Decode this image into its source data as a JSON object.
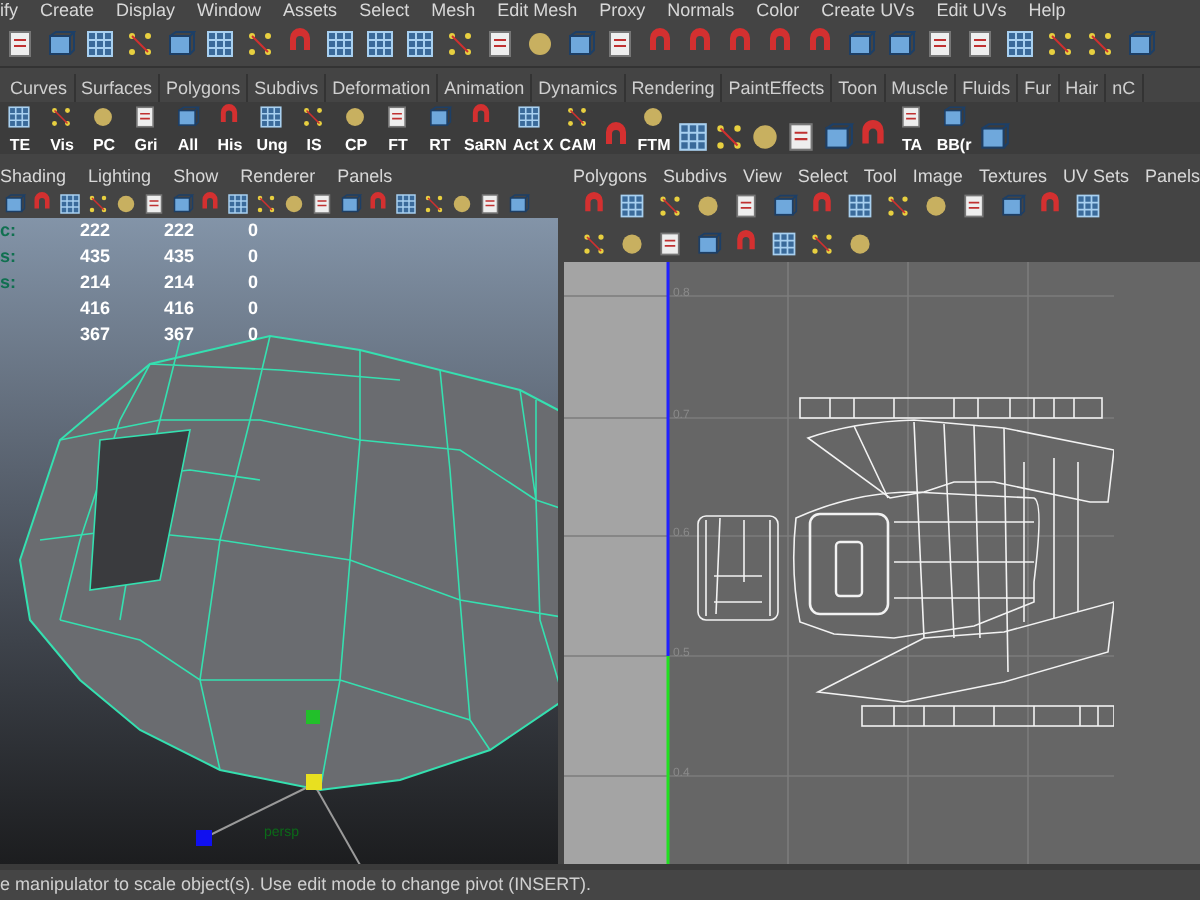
{
  "menu_bar": [
    "ify",
    "Create",
    "Display",
    "Window",
    "Assets",
    "Select",
    "Mesh",
    "Edit Mesh",
    "Proxy",
    "Normals",
    "Color",
    "Create UVs",
    "Edit UVs",
    "Help"
  ],
  "shelf_tabs": [
    {
      "label": "Curves",
      "selected": false
    },
    {
      "label": "Surfaces",
      "selected": false
    },
    {
      "label": "Polygons",
      "selected": false
    },
    {
      "label": "Subdivs",
      "selected": false
    },
    {
      "label": "Deformation",
      "selected": false
    },
    {
      "label": "Animation",
      "selected": false
    },
    {
      "label": "Dynamics",
      "selected": false
    },
    {
      "label": "Rendering",
      "selected": false
    },
    {
      "label": "PaintEffects",
      "selected": false
    },
    {
      "label": "Toon",
      "selected": false
    },
    {
      "label": "Muscle",
      "selected": false
    },
    {
      "label": "Fluids",
      "selected": false
    },
    {
      "label": "Fur",
      "selected": false
    },
    {
      "label": "Hair",
      "selected": false
    },
    {
      "label": "nC",
      "selected": false
    }
  ],
  "shelf_buttons": [
    "TE",
    "Vis",
    "PC",
    "Gri",
    "All",
    "His",
    "Ung",
    "IS",
    "CP",
    "FT",
    "RT",
    "SaRN",
    "Act X",
    "CAM",
    "FTM",
    "TA",
    "BB(r"
  ],
  "viewport": {
    "menu": [
      "Shading",
      "Lighting",
      "Show",
      "Renderer",
      "Panels"
    ],
    "hud_rows": [
      {
        "label": "c:",
        "values": [
          "222",
          "222",
          "0"
        ]
      },
      {
        "label": "s:",
        "values": [
          "435",
          "435",
          "0"
        ]
      },
      {
        "label": "s:",
        "values": [
          "214",
          "214",
          "0"
        ]
      },
      {
        "values": [
          "416",
          "416",
          "0"
        ]
      },
      {
        "values": [
          "367",
          "367",
          "0"
        ]
      }
    ],
    "camera_label": "persp"
  },
  "uv_editor": {
    "menu": [
      "Polygons",
      "Subdivs",
      "View",
      "Select",
      "Tool",
      "Image",
      "Textures",
      "UV Sets",
      "Panels"
    ],
    "grid_labels": [
      "0.8",
      "0.7",
      "0.6",
      "0.5",
      "0.4"
    ]
  },
  "status_bar": "e manipulator to scale object(s). Use edit mode to change pivot (INSERT)."
}
